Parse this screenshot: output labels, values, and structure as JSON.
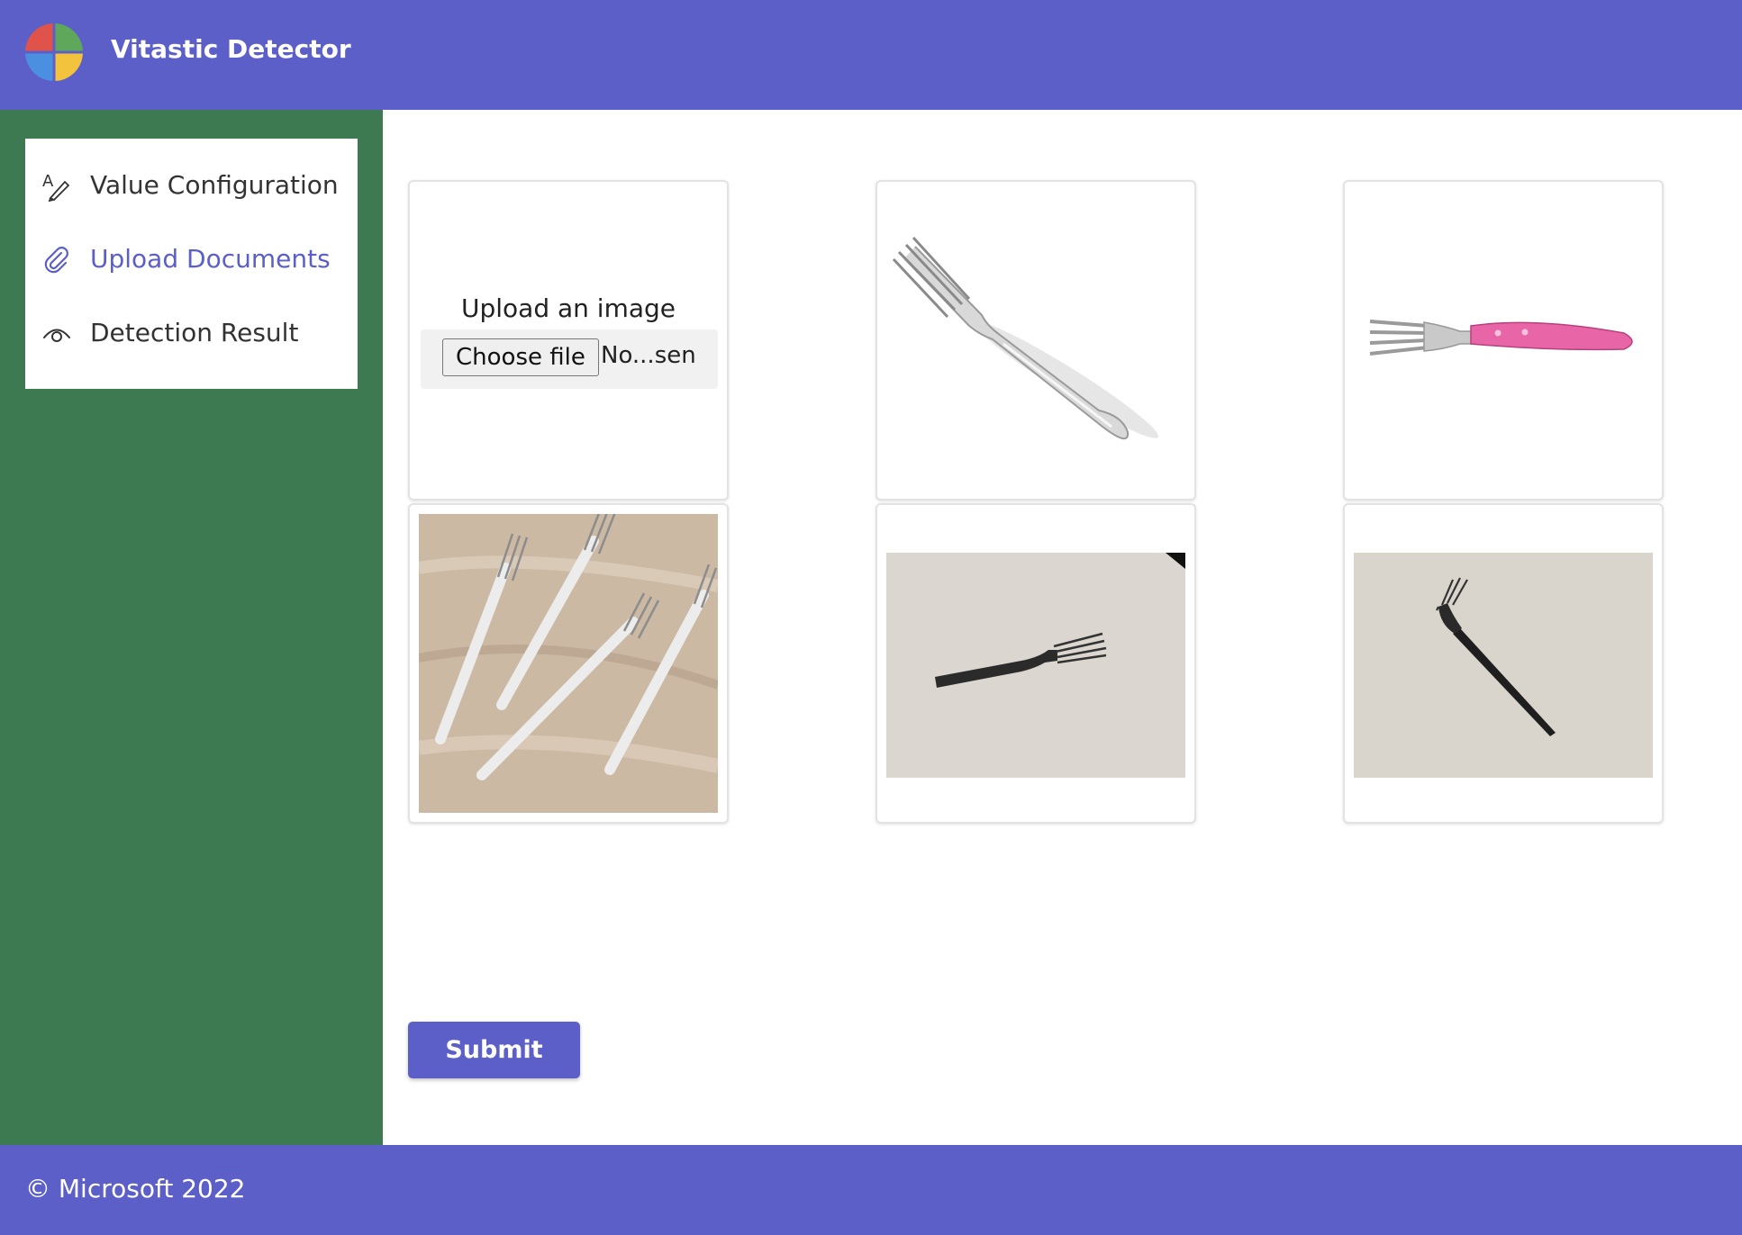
{
  "app": {
    "title": "Vitastic Detector",
    "logo_icon": "four-color-circle-logo",
    "brand_color": "#5b5fc7",
    "sidebar_color": "#3e7a51"
  },
  "sidebar": {
    "items": [
      {
        "label": "Value Configuration",
        "icon": "pen-text-icon",
        "active": false
      },
      {
        "label": "Upload Documents",
        "icon": "paperclip-icon",
        "active": true
      },
      {
        "label": "Detection Result",
        "icon": "eye-icon",
        "active": false
      }
    ]
  },
  "upload": {
    "caption": "Upload an image",
    "choose_label": "Choose file",
    "file_status": "No...sen"
  },
  "gallery": {
    "images": [
      {
        "subject": "silver fork diagonal on white"
      },
      {
        "subject": "fork with pink handle"
      },
      {
        "subject": "four silver forks on marble"
      },
      {
        "subject": "black plastic fork horizontal"
      },
      {
        "subject": "black plastic fork diagonal"
      }
    ]
  },
  "actions": {
    "submit_label": "Submit"
  },
  "footer": {
    "copyright": "© Microsoft 2022"
  }
}
